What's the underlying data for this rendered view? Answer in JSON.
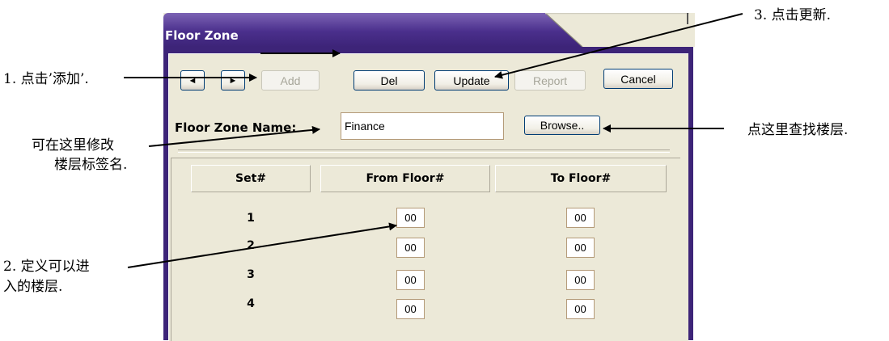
{
  "window": {
    "title": "Floor Zone"
  },
  "toolbar": {
    "prev_icon": "◄",
    "next_icon": "►",
    "add_label": "Add",
    "del_label": "Del",
    "update_label": "Update",
    "report_label": "Report",
    "cancel_label": "Cancel"
  },
  "form": {
    "zone_name_label": "Floor Zone Name:",
    "zone_name_value": "Finance",
    "browse_label": "Browse.."
  },
  "table": {
    "headers": [
      "Set#",
      "From Floor#",
      "To Floor#"
    ],
    "rows": [
      {
        "set": "1",
        "from": "00",
        "to": "00"
      },
      {
        "set": "2",
        "from": "00",
        "to": "00"
      },
      {
        "set": "3",
        "from": "00",
        "to": "00"
      },
      {
        "set": "4",
        "from": "00",
        "to": "00"
      }
    ]
  },
  "annotations": {
    "step1": "1. 点击’添加’.",
    "step3": "3. 点击更新.",
    "rename_line1": "可在这里修改",
    "rename_line2": "楼层标签名.",
    "browse_hint": "点这里查找楼层.",
    "step2_line1": "2. 定义可以进",
    "step2_line2": "入的楼层."
  }
}
